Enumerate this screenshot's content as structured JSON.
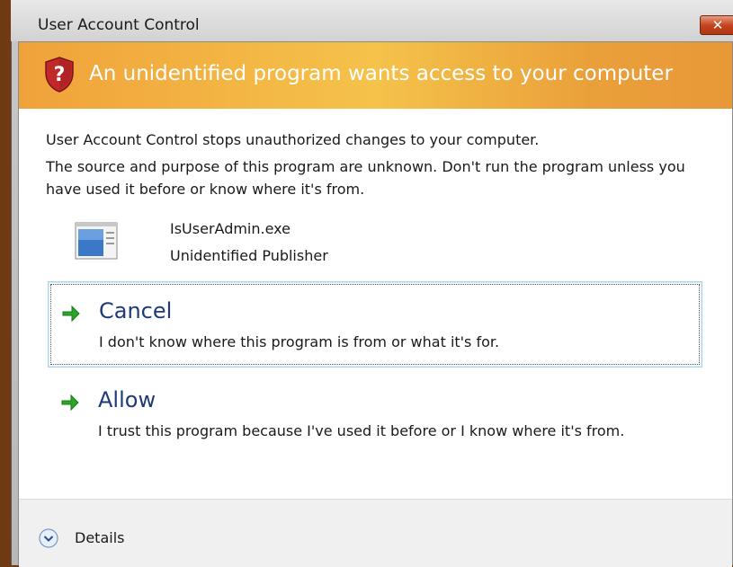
{
  "window": {
    "title": "User Account Control",
    "close_glyph": "✕"
  },
  "banner": {
    "icon": "shield-question-icon",
    "text": "An unidentified program wants access to your computer",
    "color_start": "#f0a23a",
    "color_end": "#e89838"
  },
  "description": {
    "line1": "User Account Control stops unauthorized changes to your computer.",
    "line2": "The source and purpose of this program are unknown.  Don't run the program unless you have used it before or know where it's from."
  },
  "program": {
    "icon": "application-window-icon",
    "name": "IsUserAdmin.exe",
    "publisher": "Unidentified Publisher"
  },
  "options": {
    "cancel": {
      "icon": "green-arrow-icon",
      "title": "Cancel",
      "subtitle": "I don't know where this program is from or what it's for."
    },
    "allow": {
      "icon": "green-arrow-icon",
      "title": "Allow",
      "subtitle": "I trust this program because I've used it before or I know where it's from."
    }
  },
  "details": {
    "icon": "chevron-down-circle-icon",
    "label": "Details"
  },
  "colors": {
    "link_title": "#1e3a78",
    "arrow_green": "#2aa52a",
    "shield_red": "#c0282a"
  }
}
